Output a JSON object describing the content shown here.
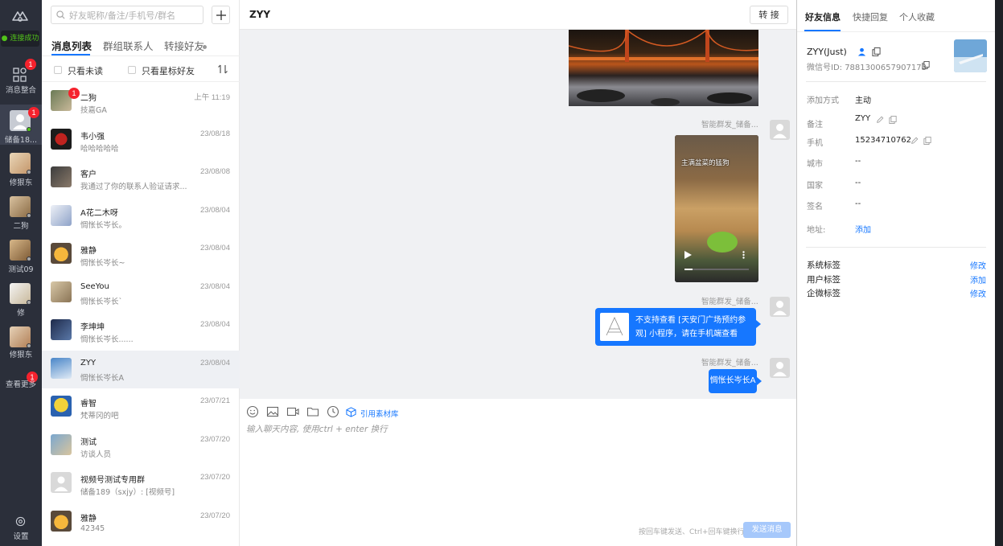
{
  "nav": {
    "connection_status": "连接成功",
    "items": [
      {
        "label": "消息整合",
        "badge": "1"
      },
      {
        "label": "储备18...",
        "badge": "1"
      },
      {
        "label": "修狠东"
      },
      {
        "label": "二狗"
      },
      {
        "label": "测试09"
      },
      {
        "label": "修"
      },
      {
        "label": "修狠东"
      },
      {
        "label": "查看更多",
        "badge": "1"
      }
    ],
    "settings_label": "设置"
  },
  "list": {
    "search_placeholder": "好友昵称/备注/手机号/群名",
    "tabs": [
      "消息列表",
      "群组联系人",
      "转接好友"
    ],
    "filter_unread": "只看未读",
    "filter_starred": "只看星标好友",
    "conversations": [
      {
        "name": "二狗",
        "time": "上午 11:19",
        "preview": "技嘉GA",
        "badge": "1"
      },
      {
        "name": "韦小强",
        "time": "23/08/18",
        "preview": "哈哈哈哈哈"
      },
      {
        "name": "客户",
        "time": "23/08/08",
        "preview": "我通过了你的联系人验证请求..."
      },
      {
        "name": "A花二木呀",
        "time": "23/08/04",
        "preview": "惆怅长岑长。"
      },
      {
        "name": "雅静",
        "time": "23/08/04",
        "preview": "惆怅长岑长~"
      },
      {
        "name": "SeeYou",
        "time": "23/08/04",
        "preview": "惆怅长岑长`"
      },
      {
        "name": "李坤坤",
        "time": "23/08/04",
        "preview": "惆怅长岑长......"
      },
      {
        "name": "ZYY",
        "time": "23/08/04",
        "preview": "惆怅长岑长A"
      },
      {
        "name": "睿智",
        "time": "23/07/21",
        "preview": "梵蒂冈的吧"
      },
      {
        "name": "测试",
        "time": "23/07/20",
        "preview": "访谈人员"
      },
      {
        "name": "视频号测试专用群",
        "time": "23/07/20",
        "preview": "储备189（sxjy）: [视频号]"
      },
      {
        "name": "雅静",
        "time": "23/07/20",
        "preview": "42345"
      }
    ]
  },
  "chat": {
    "title": "ZYY",
    "transfer_label": "转 接",
    "sender_name": "智能群发_储备...",
    "video_caption": "主满盆菜的猛狗",
    "miniprogram_text": "不支持查看 [天安门广场预约参观] 小程序，请在手机端查看",
    "last_message": "惆怅长岑长A",
    "toolbar_link": "引用素材库",
    "input_placeholder": "输入聊天内容, 使用ctrl + enter 换行",
    "send_hint": "按回车键发送、Ctrl+回车键换行",
    "send_label": "发送消息"
  },
  "info": {
    "tabs": [
      "好友信息",
      "快捷回复",
      "个人收藏"
    ],
    "name": "ZYY(Just)",
    "wechat_id_label": "微信号ID: 7881300657907173",
    "fields": {
      "add_method_label": "添加方式",
      "add_method_value": "主动",
      "remark_label": "备注",
      "remark_value": "ZYY",
      "phone_label": "手机",
      "phone_value": "15234710762",
      "city_label": "城市",
      "city_value": "--",
      "country_label": "国家",
      "country_value": "--",
      "signature_label": "签名",
      "signature_value": "--",
      "address_label": "地址:",
      "address_action": "添加"
    },
    "tags": {
      "system_label": "系统标签",
      "system_action": "修改",
      "user_label": "用户标签",
      "user_action": "添加",
      "enterprise_label": "企微标签",
      "enterprise_action": "修改"
    }
  },
  "colors": {
    "accent": "#1677ff",
    "nav_bg": "#2b2f3a",
    "badge": "#f5222d",
    "online": "#52c41a"
  }
}
